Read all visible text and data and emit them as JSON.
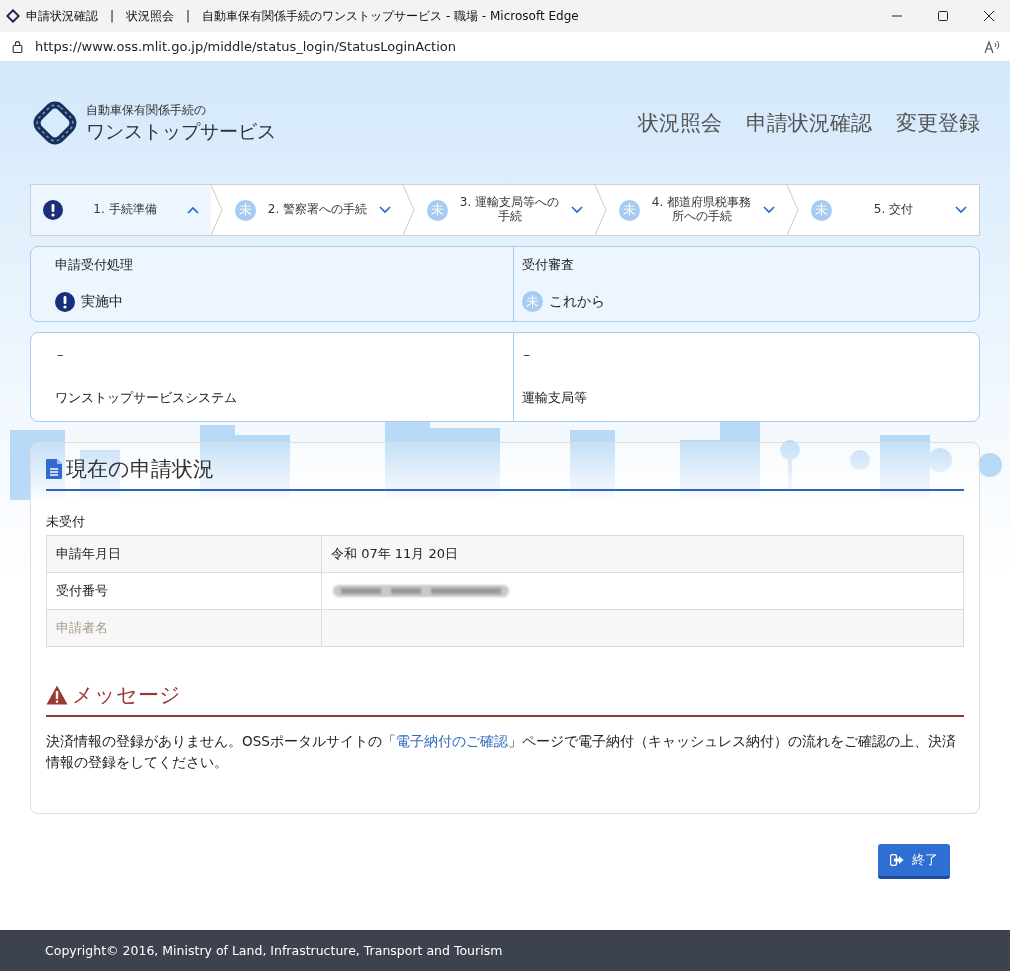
{
  "window": {
    "title": "申請状況確認　|　状況照会　|　自動車保有関係手続のワンストップサービス - 職場 - Microsoft Edge",
    "url": "https://www.oss.mlit.go.jp/middle/status_login/StatusLoginAction"
  },
  "logo": {
    "subtitle": "自動車保有関係手続の",
    "title": "ワンストップサービス"
  },
  "nav": [
    "状況照会",
    "申請状況確認",
    "変更登録"
  ],
  "steps": [
    {
      "kind": "alert",
      "label": [
        "1. 手続準備"
      ],
      "selected": true,
      "expanded": true
    },
    {
      "kind": "pending",
      "badge": "未",
      "label": [
        "2. 警察署への手続"
      ],
      "selected": false,
      "expanded": false
    },
    {
      "kind": "pending",
      "badge": "未",
      "label": [
        "3. 運輸支局等への",
        "手続"
      ],
      "selected": false,
      "expanded": false
    },
    {
      "kind": "pending",
      "badge": "未",
      "label": [
        "4. 都道府県税事務",
        "所への手続"
      ],
      "selected": false,
      "expanded": false
    },
    {
      "kind": "pending",
      "badge": "未",
      "label": [
        "5. 交付"
      ],
      "selected": false,
      "expanded": false
    }
  ],
  "process": [
    {
      "title": "申請受付処理",
      "kind": "alert",
      "status": "実施中",
      "value": "–",
      "org": "ワンストップサービスシステム"
    },
    {
      "title": "受付審査",
      "kind": "pending",
      "badge": "未",
      "status": "これから",
      "value": "–",
      "org": "運輸支局等"
    }
  ],
  "status_section": {
    "title": "現在の申請状況",
    "state": "未受付",
    "rows": [
      {
        "label": "申請年月日",
        "value": "令和 07年 11月 20日",
        "kind": "text",
        "muted": false
      },
      {
        "label": "受付番号",
        "kind": "redacted",
        "muted": false
      },
      {
        "label": "申請者名",
        "kind": "text",
        "muted": true
      }
    ]
  },
  "message": {
    "title": "メッセージ",
    "before": "決済情報の登録がありません。OSSポータルサイトの「",
    "link": "電子納付のご確認",
    "after": "」ページで電子納付（キャッシュレス納付）の流れをご確認の上、決済情報の登録をしてください。"
  },
  "exit_button": "終了",
  "footer": "Copyright© 2016, Ministry of Land, Infrastructure, Transport and Tourism"
}
